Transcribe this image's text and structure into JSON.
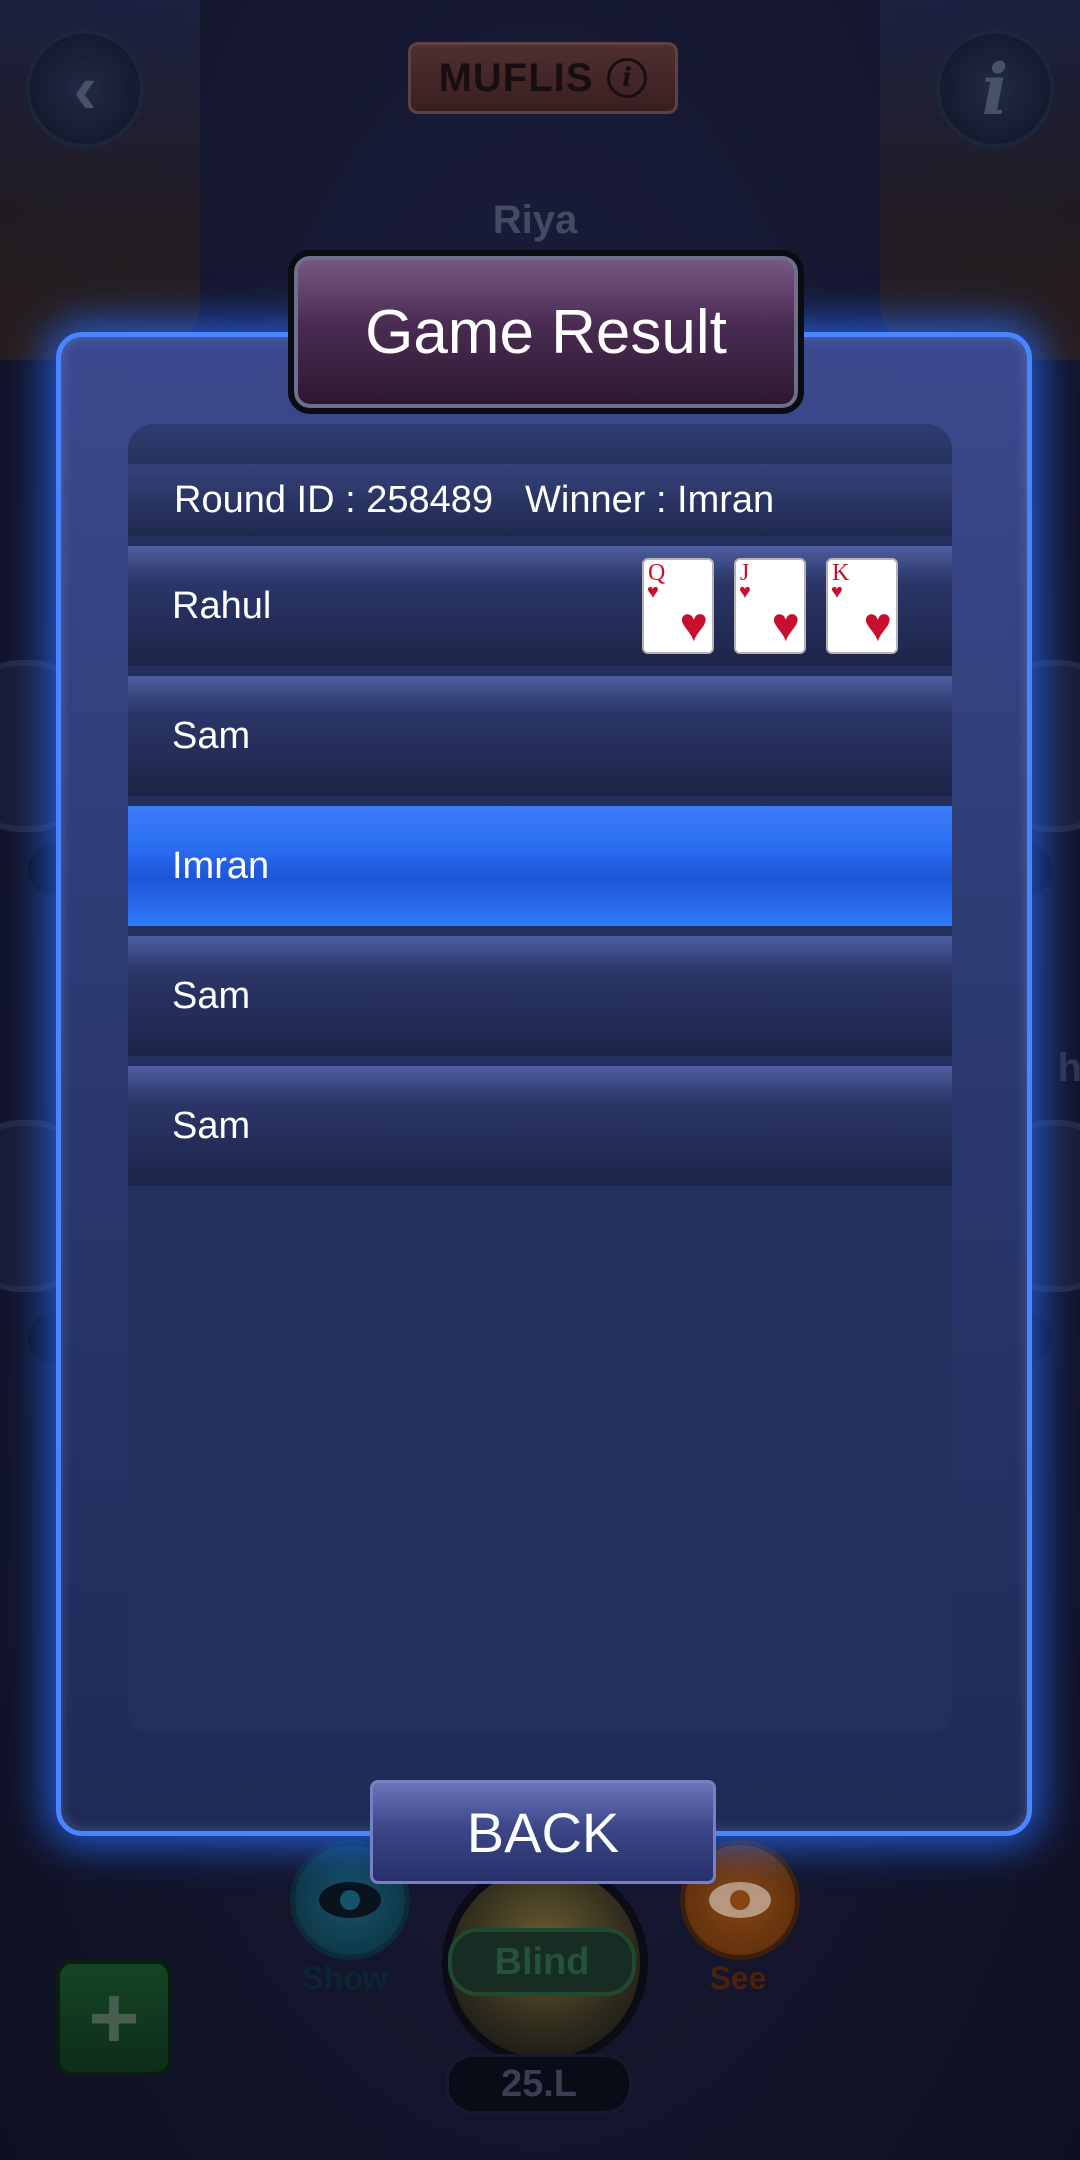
{
  "header": {
    "mode_label": "MUFLIS",
    "mode_info_glyph": "i",
    "info_glyph": "i",
    "back_glyph": "‹"
  },
  "table": {
    "opponent_top_name": "Riya",
    "side_hint": "h",
    "actions": {
      "show_label": "Show",
      "see_label": "See"
    },
    "player": {
      "status": "Blind",
      "chips": "25.L"
    },
    "add_glyph": "+"
  },
  "dialog": {
    "title": "Game Result",
    "round_info": "Round ID : 258489",
    "winner_info": "Winner : Imran",
    "players": [
      {
        "name": "Rahul",
        "cards": [
          {
            "rank": "Q",
            "suit": "♥"
          },
          {
            "rank": "J",
            "suit": "♥"
          },
          {
            "rank": "K",
            "suit": "♥"
          }
        ]
      },
      {
        "name": "Sam",
        "cards": []
      },
      {
        "name": "Imran",
        "cards": [],
        "highlighted": true
      },
      {
        "name": "Sam",
        "cards": []
      },
      {
        "name": "Sam",
        "cards": []
      }
    ],
    "back_label": "BACK"
  },
  "colors": {
    "modal_border": "#4a84ff",
    "winner_row": "#2a6df0",
    "card_suit": "#c8102e"
  }
}
